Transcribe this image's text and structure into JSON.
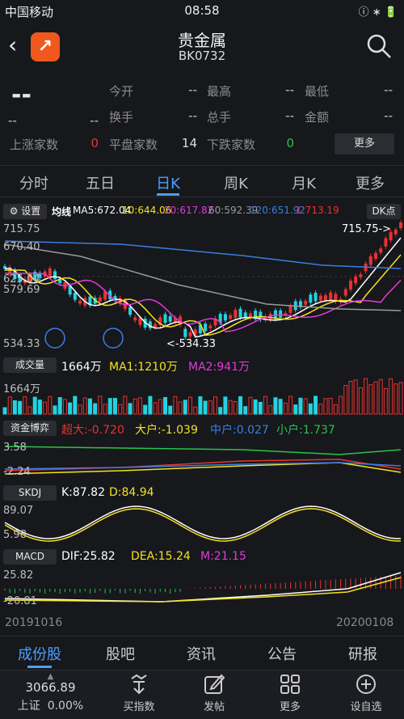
{
  "status": {
    "carrier": "中国移动",
    "time": "08:58",
    "right": "ⓘ ∗ 🔋"
  },
  "header": {
    "title": "贵金属",
    "code": "BK0732",
    "logo": "↗"
  },
  "quote": {
    "price": "--",
    "change": "--",
    "change_pct": "--",
    "fields": [
      {
        "label": "今开",
        "value": "--"
      },
      {
        "label": "最高",
        "value": "--"
      },
      {
        "label": "最低",
        "value": "--"
      },
      {
        "label": "换手",
        "value": "--"
      },
      {
        "label": "总手",
        "value": "--"
      },
      {
        "label": "金额",
        "value": "--"
      }
    ],
    "rise_label": "上涨家数",
    "rise_value": "0",
    "flat_label": "平盘家数",
    "flat_value": "14",
    "fall_label": "下跌家数",
    "fall_value": "0",
    "more": "更多"
  },
  "tabs": [
    "分时",
    "五日",
    "日K",
    "周K",
    "月K",
    "更多"
  ],
  "kline": {
    "settings": "设置",
    "ma_title": "均线",
    "ma5": "MA5:672.04",
    "ma10": "10:644.06",
    "ma20": "20:617.82",
    "ma60": "60:592.39",
    "ma120": "120:651.92",
    "ma250": "1:713.19",
    "dk": "DK点",
    "y_labels": [
      "715.75",
      "670.40",
      "625.04",
      "579.69",
      "534.33"
    ],
    "high_note": "715.75->",
    "low_note": "<-534.33",
    "colors": {
      "ma5": "#ffffff",
      "ma10": "#f5e21b",
      "ma20": "#e23bd9",
      "ma60": "#9a9a9a",
      "ma120": "#3b7ee0",
      "up": "#e8322f",
      "down": "#23d3e0"
    }
  },
  "volume": {
    "chip": "成交量",
    "value": "1664万",
    "ma1": "MA1:1210万",
    "ma2": "MA2:941万",
    "axis": "1664万"
  },
  "fund": {
    "chip": "资金博弈",
    "super": "超大:-0.720",
    "big": "大户:-1.039",
    "mid": "中户:0.027",
    "small": "小户:1.737",
    "axis_top": "3.58",
    "axis_bot": "-2.24"
  },
  "skdj": {
    "chip": "SKDJ",
    "k": "K:87.82",
    "d": "D:84.94",
    "axis_top": "89.07",
    "axis_bot": "5.98"
  },
  "macd": {
    "chip": "MACD",
    "dif": "DIF:25.82",
    "dea": "DEA:15.24",
    "m": "M:21.15",
    "axis_top": "25.82",
    "axis_bot": "-20.81"
  },
  "dates": {
    "start": "20191016",
    "end": "20200108"
  },
  "bottom_tabs": [
    "成份股",
    "股吧",
    "资讯",
    "公告",
    "研报"
  ],
  "toolbar": {
    "index_value": "3066.89",
    "index_name": "上证",
    "index_pct": "0.00%",
    "items": [
      "买指数",
      "发帖",
      "更多",
      "设自选"
    ]
  }
}
